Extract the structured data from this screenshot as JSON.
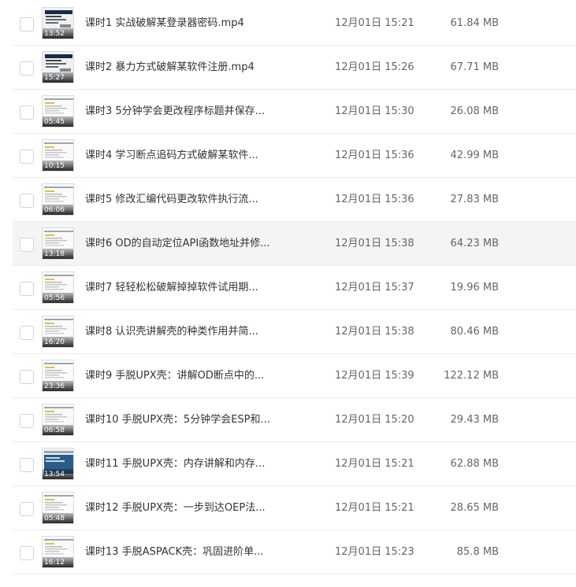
{
  "files": [
    {
      "name": "课时1 实战破解某登录器密码.mp4",
      "date": "12月01日 15:21",
      "size": "61.84 MB",
      "duration": "13:52",
      "thumb": "dark"
    },
    {
      "name": "课时2 暴力方式破解某软件注册.mp4",
      "date": "12月01日 15:26",
      "size": "67.71 MB",
      "duration": "15:27",
      "thumb": "dark"
    },
    {
      "name": "课时3 5分钟学会更改程序标题并保存...",
      "date": "12月01日 15:30",
      "size": "26.08 MB",
      "duration": "05:45",
      "thumb": "light"
    },
    {
      "name": "课时4 学习断点追码方式破解某软件...",
      "date": "12月01日 15:36",
      "size": "42.99 MB",
      "duration": "10:15",
      "thumb": "light"
    },
    {
      "name": "课时5 修改汇编代码更改软件执行流...",
      "date": "12月01日 15:36",
      "size": "27.83 MB",
      "duration": "06:06",
      "thumb": "light"
    },
    {
      "name": "课时6 OD的自动定位API函数地址并修...",
      "date": "12月01日 15:38",
      "size": "64.23 MB",
      "duration": "13:18",
      "thumb": "light",
      "hover": true
    },
    {
      "name": "课时7 轻轻松松破解掉掉软件试用期...",
      "date": "12月01日 15:37",
      "size": "19.96 MB",
      "duration": "05:56",
      "thumb": "light"
    },
    {
      "name": "课时8 认识壳讲解壳的种类作用并简...",
      "date": "12月01日 15:38",
      "size": "80.46 MB",
      "duration": "16:20",
      "thumb": "light"
    },
    {
      "name": "课时9 手脱UPX壳：讲解OD断点中的...",
      "date": "12月01日 15:39",
      "size": "122.12 MB",
      "duration": "23:36",
      "thumb": "light"
    },
    {
      "name": "课时10 手脱UPX壳：5分钟学会ESP和...",
      "date": "12月01日 15:20",
      "size": "29.43 MB",
      "duration": "06:58",
      "thumb": "light"
    },
    {
      "name": "课时11 手脱UPX壳：内存讲解和内存...",
      "date": "12月01日 15:21",
      "size": "62.88 MB",
      "duration": "13:54",
      "thumb": "blue"
    },
    {
      "name": "课时12 手脱UPX壳：一步到达OEP法...",
      "date": "12月01日 15:21",
      "size": "28.65 MB",
      "duration": "05:48",
      "thumb": "light"
    },
    {
      "name": "课时13 手脱ASPACK壳：巩固进阶单...",
      "date": "12月01日 15:23",
      "size": "85.8 MB",
      "duration": "16:12",
      "thumb": "light"
    }
  ],
  "colors": {
    "row_hover": "#f4f4f4",
    "divider": "#ececec",
    "name_text": "#333333",
    "meta_text": "#666666"
  }
}
